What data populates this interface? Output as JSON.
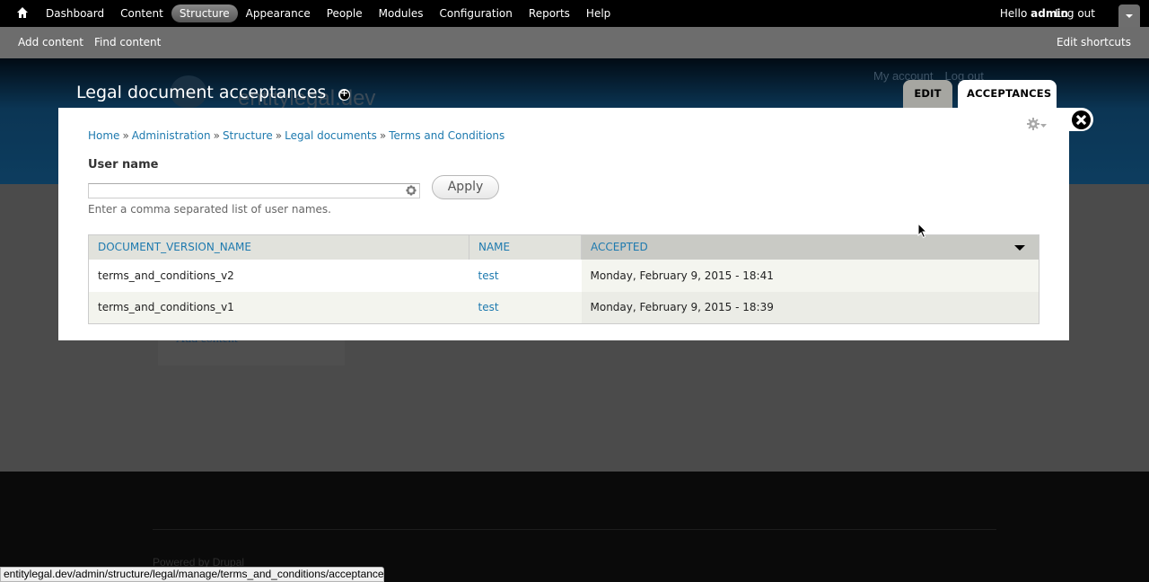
{
  "toolbar": {
    "home_icon": "home-icon",
    "menu": [
      {
        "label": "Dashboard",
        "active": false
      },
      {
        "label": "Content",
        "active": false
      },
      {
        "label": "Structure",
        "active": true
      },
      {
        "label": "Appearance",
        "active": false
      },
      {
        "label": "People",
        "active": false
      },
      {
        "label": "Modules",
        "active": false
      },
      {
        "label": "Configuration",
        "active": false
      },
      {
        "label": "Reports",
        "active": false
      },
      {
        "label": "Help",
        "active": false
      }
    ],
    "greeting": "Hello",
    "username": "admin",
    "logout": "Log out",
    "drawer_icon": "chevron-down-icon"
  },
  "shortcuts": {
    "items": [
      "Add content",
      "Find content"
    ],
    "edit": "Edit shortcuts"
  },
  "background_page": {
    "site_name": "entitylegal.dev",
    "secondary_menu": [
      "My account",
      "Log out"
    ],
    "add_content": "Add content",
    "powered_by": "Powered by Drupal"
  },
  "overlay": {
    "title": "Legal document acceptances",
    "tabs": [
      {
        "label": "EDIT",
        "active": false
      },
      {
        "label": "ACCEPTANCES",
        "active": true
      }
    ],
    "breadcrumb": [
      "Home",
      "Administration",
      "Structure",
      "Legal documents",
      "Terms and Conditions"
    ],
    "breadcrumb_separator": "»",
    "filter": {
      "label": "User name",
      "value": "",
      "placeholder": "",
      "description": "Enter a comma separated list of user names.",
      "apply": "Apply"
    },
    "table": {
      "columns": [
        "DOCUMENT_VERSION_NAME",
        "NAME",
        "ACCEPTED"
      ],
      "sorted_column": "ACCEPTED",
      "sort_direction": "desc",
      "rows": [
        {
          "document_version_name": "terms_and_conditions_v2",
          "name": "test",
          "accepted": "Monday, February 9, 2015 - 18:41"
        },
        {
          "document_version_name": "terms_and_conditions_v1",
          "name": "test",
          "accepted": "Monday, February 9, 2015 - 18:39"
        }
      ]
    }
  },
  "statusbar": {
    "url": "entitylegal.dev/admin/structure/legal/manage/terms_and_conditions/acceptances"
  },
  "colors": {
    "link": "#1e7aaf",
    "toolbar_bg": "#000000",
    "shortcuts_bg": "#6d6d6d",
    "header_bg": "#0d3d5f"
  }
}
